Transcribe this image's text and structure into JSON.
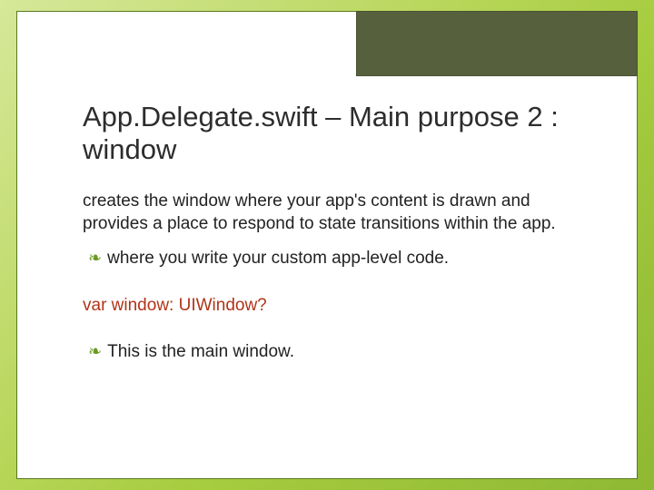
{
  "slide": {
    "title": "App.Delegate.swift – Main purpose 2 :  window",
    "para1": "creates the window where your app's content is drawn and provides a place to respond to state transitions within the app.",
    "bullet1": "where you write your custom app-level code.",
    "code": "var window: UIWindow?",
    "bullet2": "This is the main window.",
    "bullet_glyph": "❧"
  }
}
